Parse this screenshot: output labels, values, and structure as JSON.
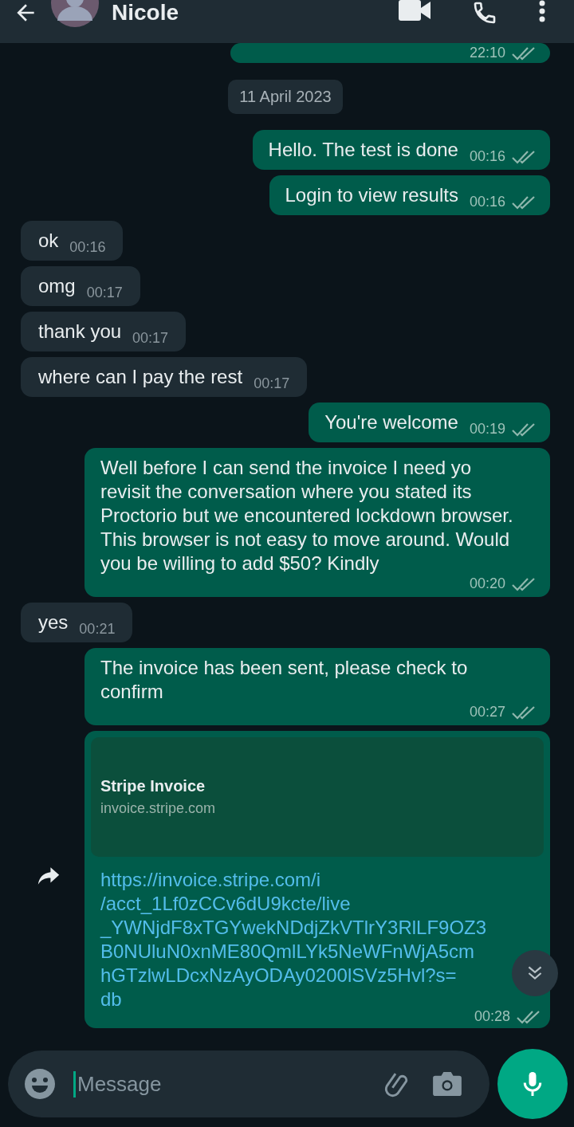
{
  "header": {
    "name": "Nicole"
  },
  "messages": [
    {
      "kind": "out",
      "time": "22:10"
    },
    {
      "kind": "date",
      "text": "11 April 2023"
    },
    {
      "kind": "out",
      "text": "Hello. The test is done",
      "time": "00:16"
    },
    {
      "kind": "out",
      "text": "Login to view results",
      "time": "00:16"
    },
    {
      "kind": "in",
      "text": "ok",
      "time": "00:16"
    },
    {
      "kind": "in",
      "text": "omg",
      "time": "00:17"
    },
    {
      "kind": "in",
      "text": "thank you",
      "time": "00:17"
    },
    {
      "kind": "in",
      "text": "where can I pay the rest",
      "time": "00:17"
    },
    {
      "kind": "out",
      "text": "You're welcome",
      "time": "00:19"
    },
    {
      "kind": "out",
      "text": "Well before I can send the invoice I need yo revisit the conversation where you stated its Proctorio but we encountered lockdown browser. This browser is not easy to move around.  Would you be willing to add $50? Kindly",
      "time": "00:20"
    },
    {
      "kind": "in",
      "text": "yes",
      "time": "00:21"
    },
    {
      "kind": "out",
      "text": "The invoice has been sent, please check to confirm",
      "time": "00:27"
    },
    {
      "kind": "link",
      "title": "Stripe Invoice",
      "domain": "invoice.stripe.com",
      "lines": [
        "https://invoice.stripe.com/i",
        "/acct_1Lf0zCCv6dU9kcte/live",
        "_YWNjdF8xTGYwekNDdjZkVTlrY3RlLF9OZ3",
        "B0NUluN0xnME80QmlLYk5NeWFnWjA5cm",
        "hGTzlwLDcxNzAyODAy0200lSVz5Hvl?s=",
        "db"
      ],
      "time": "00:28"
    }
  ],
  "composer": {
    "placeholder": "Message"
  }
}
